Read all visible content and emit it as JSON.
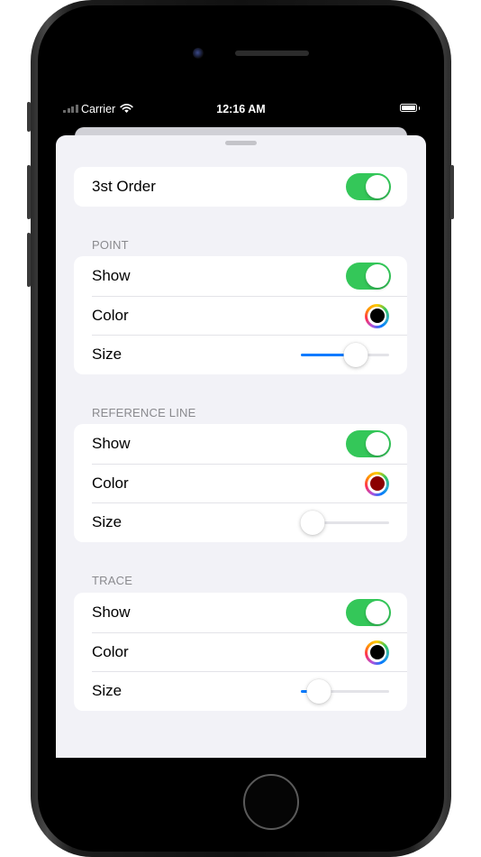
{
  "status_bar": {
    "carrier": "Carrier",
    "time": "12:16 AM"
  },
  "top_group": {
    "label": "3st Order",
    "enabled": true
  },
  "sections": [
    {
      "header": "POINT",
      "show_label": "Show",
      "show": true,
      "color_label": "Color",
      "color": "#000000",
      "size_label": "Size",
      "size_fraction": 0.62
    },
    {
      "header": "REFERENCE LINE",
      "show_label": "Show",
      "show": true,
      "color_label": "Color",
      "color": "#8b0000",
      "size_label": "Size",
      "size_fraction": 0.13
    },
    {
      "header": "TRACE",
      "show_label": "Show",
      "show": true,
      "color_label": "Color",
      "color": "#000000",
      "size_label": "Size",
      "size_fraction": 0.2
    }
  ],
  "colors": {
    "toggle_on": "#34c759",
    "slider_fill": "#007aff",
    "background": "#f2f2f7"
  },
  "icons": [
    "wifi-icon",
    "battery-icon",
    "signal-icon",
    "camera-icon",
    "home-button-icon"
  ]
}
